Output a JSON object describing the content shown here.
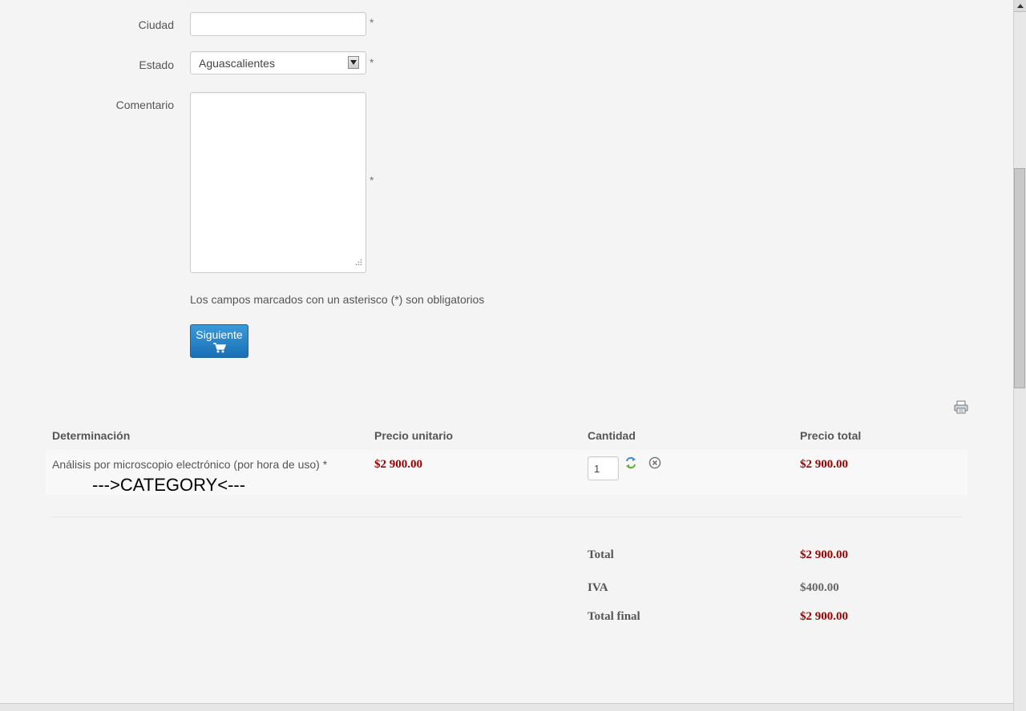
{
  "form": {
    "city_label": "Ciudad",
    "city_value": "",
    "state_label": "Estado",
    "state_value": "Aguascalientes",
    "comment_label": "Comentario",
    "comment_value": "",
    "required_mark": "*",
    "required_note": "Los campos marcados con un asterisco (*) son obligatorios",
    "next_button_label": "Siguiente"
  },
  "cart": {
    "headers": {
      "item": "Determinación",
      "unit_price": "Precio unitario",
      "quantity": "Cantidad",
      "total_price": "Precio total"
    },
    "rows": [
      {
        "name": "Análisis por microscopio electrónico (por hora de uso) *",
        "category": "--->CATEGORY<---",
        "unit_price": "$2 900.00",
        "quantity": "1",
        "total_price": "$2 900.00"
      }
    ],
    "totals": {
      "total_label": "Total",
      "total_value": "$2 900.00",
      "tax_label": "IVA",
      "tax_value": "$400.00",
      "final_label": "Total final",
      "final_value": "$2 900.00"
    }
  },
  "icons": {
    "print": "printer-icon",
    "cart": "cart-icon",
    "refresh": "refresh-icon",
    "remove": "remove-icon",
    "select_arrow": "chevron-down-icon"
  },
  "colors": {
    "price_red": "#990000",
    "button_blue": "#1a6fb5",
    "background": "#f4f4f4"
  }
}
